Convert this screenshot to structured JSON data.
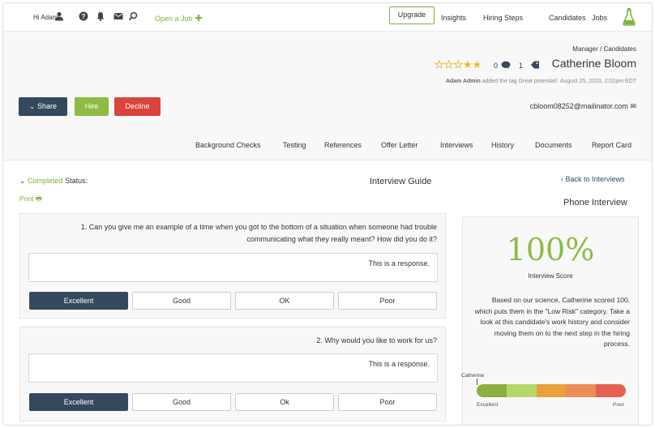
{
  "nav": {
    "jobs": "Jobs",
    "candidates": "Candidates",
    "hiring_steps": "Hiring Steps",
    "insights": "Insights",
    "upgrade": "Upgrade",
    "open_job": "Open a Job",
    "greeting": "Hi Adam"
  },
  "candidate": {
    "breadcrumb": "Manager / Candidates",
    "name": "Catherine Bloom",
    "rating_count": "1",
    "comment_count": "0",
    "stars_filled": 2,
    "stars_total": 5,
    "activity_user": "Adam Admin",
    "activity_text": " added the tag Great potential!. August 25, 2023, 2:02pm EDT",
    "email": "cbloom08252@mailinator.com"
  },
  "actions": {
    "share": "Share",
    "hire": "Hire",
    "decline": "Decline"
  },
  "tabs": [
    "Report Card",
    "Documents",
    "History",
    "Interviews",
    "Offer Letter",
    "References",
    "Testing",
    "Background Checks"
  ],
  "interview": {
    "back": "Back to Interviews",
    "type": "Phone Interview",
    "score": "100%",
    "score_label": "Interview Score",
    "summary": "Based on our science, Catherine scored 100, which puts them in the \"Low Risk\" category. Take a look at this candidate's work history and consider moving them on to the next step in the hiring process.",
    "meter_name": "Catherine",
    "meter_excellent": "Excellent",
    "meter_poor": "Poor",
    "meter_colors": [
      "#8aaf3f",
      "#b5d76a",
      "#e7a03a",
      "#ec8d58",
      "#e5604e"
    ]
  },
  "guide": {
    "title": "Interview Guide",
    "status_label": "Status:",
    "status_value": "Completed",
    "print": "Print",
    "questions": [
      {
        "number": "1.",
        "text": "Can you give me an example of a time when you got to the bottom of a situation when someone had trouble communicating what they really meant? How did you do it?",
        "response": "This is a response.",
        "grade": "Excellent"
      },
      {
        "number": "2.",
        "text": "Why would you like to work for us?",
        "response": "This is a response.",
        "grade": "Excellent"
      }
    ],
    "grades": [
      "Poor",
      "OK",
      "Good",
      "Excellent"
    ],
    "grades_q2": [
      "Poor",
      "Ok",
      "Good",
      "Excellent"
    ]
  },
  "colors": {
    "accent_green": "#7ab33e",
    "navy": "#34495e",
    "decline_red": "#d9443c"
  }
}
